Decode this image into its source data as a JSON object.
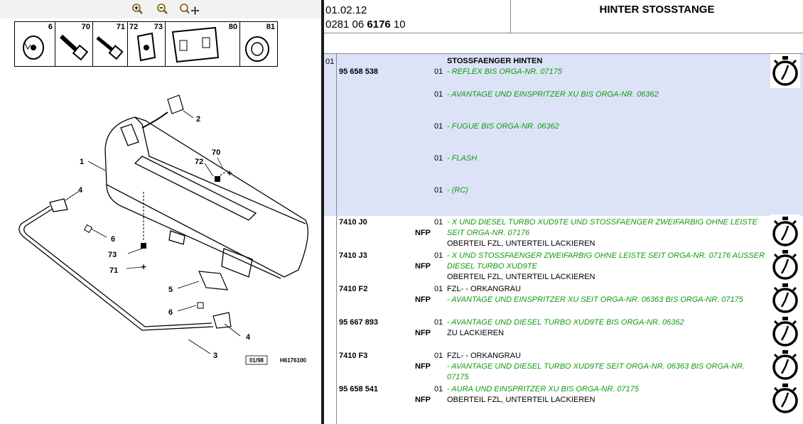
{
  "toolbar": {
    "icons": [
      "zoom-in-icon",
      "zoom-out-icon",
      "zoom-move-icon"
    ]
  },
  "thumbnails": [
    {
      "num": "6"
    },
    {
      "num": "70"
    },
    {
      "num": "71"
    },
    {
      "num": "72"
    },
    {
      "num": "73"
    },
    {
      "num": "80"
    },
    {
      "num": "81"
    }
  ],
  "diagram": {
    "callouts": [
      "1",
      "2",
      "70",
      "72",
      "4",
      "6",
      "73",
      "71",
      "5",
      "6",
      "4",
      "3"
    ],
    "date_box": "01/98",
    "code": "H6176100"
  },
  "header": {
    "date": "01.02.12",
    "ref_prefix": "0281 06 ",
    "ref_bold": "6176",
    "ref_suffix": " 10",
    "title": "HINTER STOSSTANGE"
  },
  "colors": {
    "highlight": "#dce3f7",
    "note_green": "#119a11"
  },
  "rows": [
    {
      "num": "01",
      "part": "95 658 538",
      "title": "STOSSFAENGER HINTEN",
      "items": [
        {
          "seq": "01",
          "text": "- REFLEX BIS ORGA-NR. 07175"
        },
        {
          "seq": "01",
          "text": "- AVANTAGE UND EINSPRITZER XU BIS ORGA-NR. 06362"
        },
        {
          "seq": "01",
          "text": "- FUGUE BIS ORGA-NR. 06362"
        },
        {
          "seq": "01",
          "text": "- FLASH"
        },
        {
          "seq": "01",
          "text": "- (RC)"
        }
      ]
    },
    {
      "part": "7410 J0",
      "nfp": "NFP",
      "seq": "01",
      "green": [
        "- X UND DIESEL TURBO XUD9TE UND STOSSFAENGER ZWEIFARBIG OHNE LEISTE",
        "SEIT ORGA-NR. 07176"
      ],
      "black": [
        "OBERTEIL FZL, UNTERTEIL LACKIEREN"
      ]
    },
    {
      "part": "7410 J3",
      "nfp": "NFP",
      "seq": "01",
      "green": [
        "- X UND STOSSFAENGER ZWEIFARBIG OHNE LEISTE SEIT ORGA-NR. 07176 AUSSER",
        "DIESEL TURBO XUD9TE"
      ],
      "black": [
        "OBERTEIL FZL, UNTERTEIL LACKIEREN"
      ]
    },
    {
      "part": "7410 F2",
      "nfp": "NFP",
      "seq": "01",
      "black_first": "FZL- - ORKANGRAU",
      "green": [
        "- AVANTAGE UND EINSPRITZER XU SEIT ORGA-NR. 06363 BIS ORGA-NR. 07175"
      ]
    },
    {
      "part": "95 667 893",
      "nfp": "NFP",
      "seq": "01",
      "green": [
        "- AVANTAGE UND DIESEL TURBO XUD9TE BIS ORGA-NR. 06362"
      ],
      "black": [
        "ZU LACKIEREN"
      ]
    },
    {
      "part": "7410 F3",
      "nfp": "NFP",
      "seq": "01",
      "black_first": "FZL- - ORKANGRAU",
      "green": [
        "- AVANTAGE UND DIESEL TURBO XUD9TE SEIT ORGA-NR. 06363 BIS ORGA-NR.",
        "07175"
      ]
    },
    {
      "part": "95 658 541",
      "nfp": "NFP",
      "seq": "01",
      "green": [
        "- AURA UND EINSPRITZER XU BIS ORGA-NR. 07175"
      ],
      "black": [
        "OBERTEIL FZL, UNTERTEIL LACKIEREN"
      ]
    }
  ]
}
